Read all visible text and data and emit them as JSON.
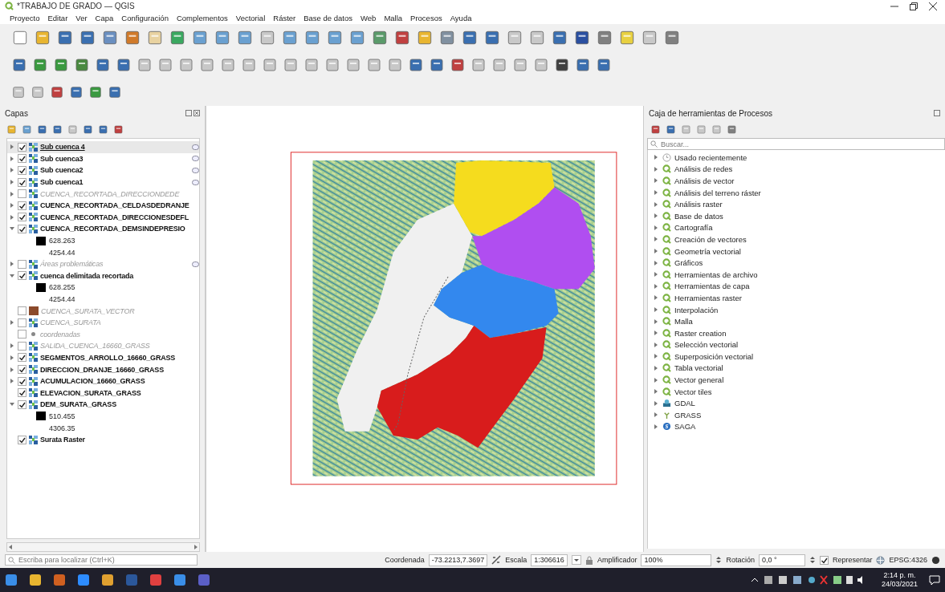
{
  "window": {
    "title": "*TRABAJO DE GRADO — QGIS"
  },
  "menu": [
    "Proyecto",
    "Editar",
    "Ver",
    "Capa",
    "Configuración",
    "Complementos",
    "Vectorial",
    "Ráster",
    "Base de datos",
    "Web",
    "Malla",
    "Procesos",
    "Ayuda"
  ],
  "layers_panel": {
    "title": "Capas",
    "items": [
      {
        "name": "Sub cuenca 4",
        "kind": "raster",
        "checked": true,
        "selected": true,
        "expanded": false,
        "indicator": true
      },
      {
        "name": "Sub cuenca3",
        "kind": "raster",
        "checked": true,
        "selected": false,
        "expanded": false,
        "indicator": true
      },
      {
        "name": "Sub cuenca2",
        "kind": "raster",
        "checked": true,
        "selected": false,
        "expanded": false,
        "indicator": true
      },
      {
        "name": "Sub cuenca1",
        "kind": "raster",
        "checked": true,
        "selected": false,
        "expanded": false,
        "indicator": true
      },
      {
        "name": "CUENCA_RECORTADA_DIRECCIONDEDE",
        "kind": "raster",
        "checked": false,
        "selected": false,
        "expanded": false,
        "indicator": false
      },
      {
        "name": "CUENCA_RECORTADA_CELDASDEDRANJE",
        "kind": "raster",
        "checked": true,
        "selected": false,
        "expanded": false,
        "indicator": false
      },
      {
        "name": "CUENCA_RECORTADA_DIRECCIONESDEFL",
        "kind": "raster",
        "checked": true,
        "selected": false,
        "expanded": false,
        "indicator": false
      },
      {
        "name": "CUENCA_RECORTADA_DEMSINDEPRESIO",
        "kind": "raster",
        "checked": true,
        "selected": false,
        "expanded": true,
        "indicator": false,
        "legend": [
          {
            "label": "628.263",
            "color": "#000000"
          },
          {
            "label": "4254.44"
          }
        ]
      },
      {
        "name": "Áreas problemáticas",
        "kind": "raster",
        "checked": false,
        "selected": false,
        "expanded": false,
        "indicator": true
      },
      {
        "name": "cuenca delimitada recortada",
        "kind": "raster",
        "checked": true,
        "selected": false,
        "expanded": true,
        "indicator": false,
        "legend": [
          {
            "label": "628.255",
            "color": "#000000"
          },
          {
            "label": "4254.44"
          }
        ]
      },
      {
        "name": "CUENCA_SURATA_VECTOR",
        "kind": "polygon",
        "color": "#8b4a2b",
        "checked": false,
        "selected": false,
        "indicator": false
      },
      {
        "name": "CUENCA_SURATA",
        "kind": "raster",
        "checked": false,
        "selected": false,
        "expanded": false,
        "indicator": false
      },
      {
        "name": "coordenadas",
        "kind": "point",
        "checked": false,
        "selected": false,
        "indicator": false
      },
      {
        "name": "SALIDA_CUENCA_16660_GRASS",
        "kind": "raster",
        "checked": false,
        "selected": false,
        "expanded": false,
        "indicator": false
      },
      {
        "name": "SEGMENTOS_ARROLLO_16660_GRASS",
        "kind": "raster",
        "checked": true,
        "selected": false,
        "expanded": false,
        "indicator": false
      },
      {
        "name": "DIRECCION_DRANJE_16660_GRASS",
        "kind": "raster",
        "checked": true,
        "selected": false,
        "expanded": false,
        "indicator": false
      },
      {
        "name": "ACUMULACION_16660_GRASS",
        "kind": "raster",
        "checked": true,
        "selected": false,
        "expanded": false,
        "indicator": false
      },
      {
        "name": "ELEVACION_SURATA_GRASS",
        "kind": "raster",
        "checked": true,
        "selected": false,
        "indicator": false
      },
      {
        "name": "DEM_SURATA_GRASS",
        "kind": "raster",
        "checked": true,
        "selected": false,
        "expanded": true,
        "indicator": false,
        "legend": [
          {
            "label": "510.455",
            "color": "#000000"
          },
          {
            "label": "4306.35"
          }
        ]
      },
      {
        "name": "Surata Raster",
        "kind": "raster",
        "checked": true,
        "selected": false,
        "indicator": false
      }
    ]
  },
  "processing_panel": {
    "title": "Caja de herramientas de Procesos",
    "search": {
      "placeholder": "Buscar..."
    },
    "items": [
      {
        "label": "Usado recientemente",
        "kind": "recent"
      },
      {
        "label": "Análisis de redes",
        "kind": "qgis"
      },
      {
        "label": "Análisis de vector",
        "kind": "qgis"
      },
      {
        "label": "Análisis del terreno ráster",
        "kind": "qgis"
      },
      {
        "label": "Análisis raster",
        "kind": "qgis"
      },
      {
        "label": "Base de datos",
        "kind": "qgis"
      },
      {
        "label": "Cartografía",
        "kind": "qgis"
      },
      {
        "label": "Creación de vectores",
        "kind": "qgis"
      },
      {
        "label": "Geometría vectorial",
        "kind": "qgis"
      },
      {
        "label": "Gráficos",
        "kind": "qgis"
      },
      {
        "label": "Herramientas de archivo",
        "kind": "qgis"
      },
      {
        "label": "Herramientas de capa",
        "kind": "qgis"
      },
      {
        "label": "Herramientas raster",
        "kind": "qgis"
      },
      {
        "label": "Interpolación",
        "kind": "qgis"
      },
      {
        "label": "Malla",
        "kind": "qgis"
      },
      {
        "label": "Raster creation",
        "kind": "qgis"
      },
      {
        "label": "Selección vectorial",
        "kind": "qgis"
      },
      {
        "label": "Superposición vectorial",
        "kind": "qgis"
      },
      {
        "label": "Tabla vectorial",
        "kind": "qgis"
      },
      {
        "label": "Vector general",
        "kind": "qgis"
      },
      {
        "label": "Vector tiles",
        "kind": "qgis"
      },
      {
        "label": "GDAL",
        "kind": "gdal"
      },
      {
        "label": "GRASS",
        "kind": "grass"
      },
      {
        "label": "SAGA",
        "kind": "saga"
      }
    ]
  },
  "status_bar": {
    "locator": {
      "placeholder": "Escriba para localizar (Ctrl+K)"
    },
    "coordinate_label": "Coordenada",
    "coordinate": "-73.2213,7.3697",
    "scale_label": "Escala",
    "scale": "1:306616",
    "magnifier_label": "Amplificador",
    "magnifier": "100%",
    "rotation_label": "Rotación",
    "rotation": "0,0 °",
    "render_label": "Representar",
    "render_checked": true,
    "crs": "EPSG:4326"
  },
  "taskbar": {
    "time": "2:14 p. m.",
    "date": "24/03/2021"
  }
}
